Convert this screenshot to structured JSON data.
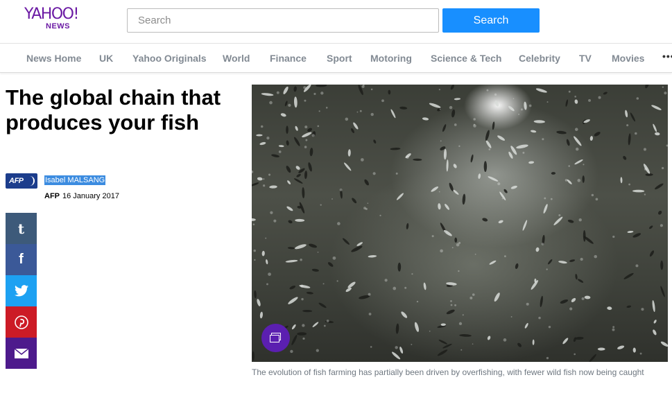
{
  "header": {
    "logo_main": "YAHOO!",
    "logo_sub": "NEWS",
    "search_placeholder": "Search",
    "search_button": "Search",
    "accent_color": "#188fff",
    "brand_color": "#6b1aa4"
  },
  "nav": {
    "items": [
      "News Home",
      "UK",
      "Yahoo Originals",
      "World",
      "Finance",
      "Sport",
      "Motoring",
      "Science & Tech",
      "Celebrity",
      "TV",
      "Movies"
    ],
    "more": "•••"
  },
  "article": {
    "title": "The global chain that produces your fish",
    "source_logo": "AFP",
    "author": "Isabel MALSANG",
    "source": "AFP",
    "date": "16 January 2017",
    "caption": "The evolution of fish farming has partially been driven by overfishing, with fewer wild fish now being caught"
  },
  "share": {
    "icons": [
      "tumblr-icon",
      "facebook-icon",
      "twitter-icon",
      "pinterest-icon",
      "mail-icon"
    ]
  }
}
